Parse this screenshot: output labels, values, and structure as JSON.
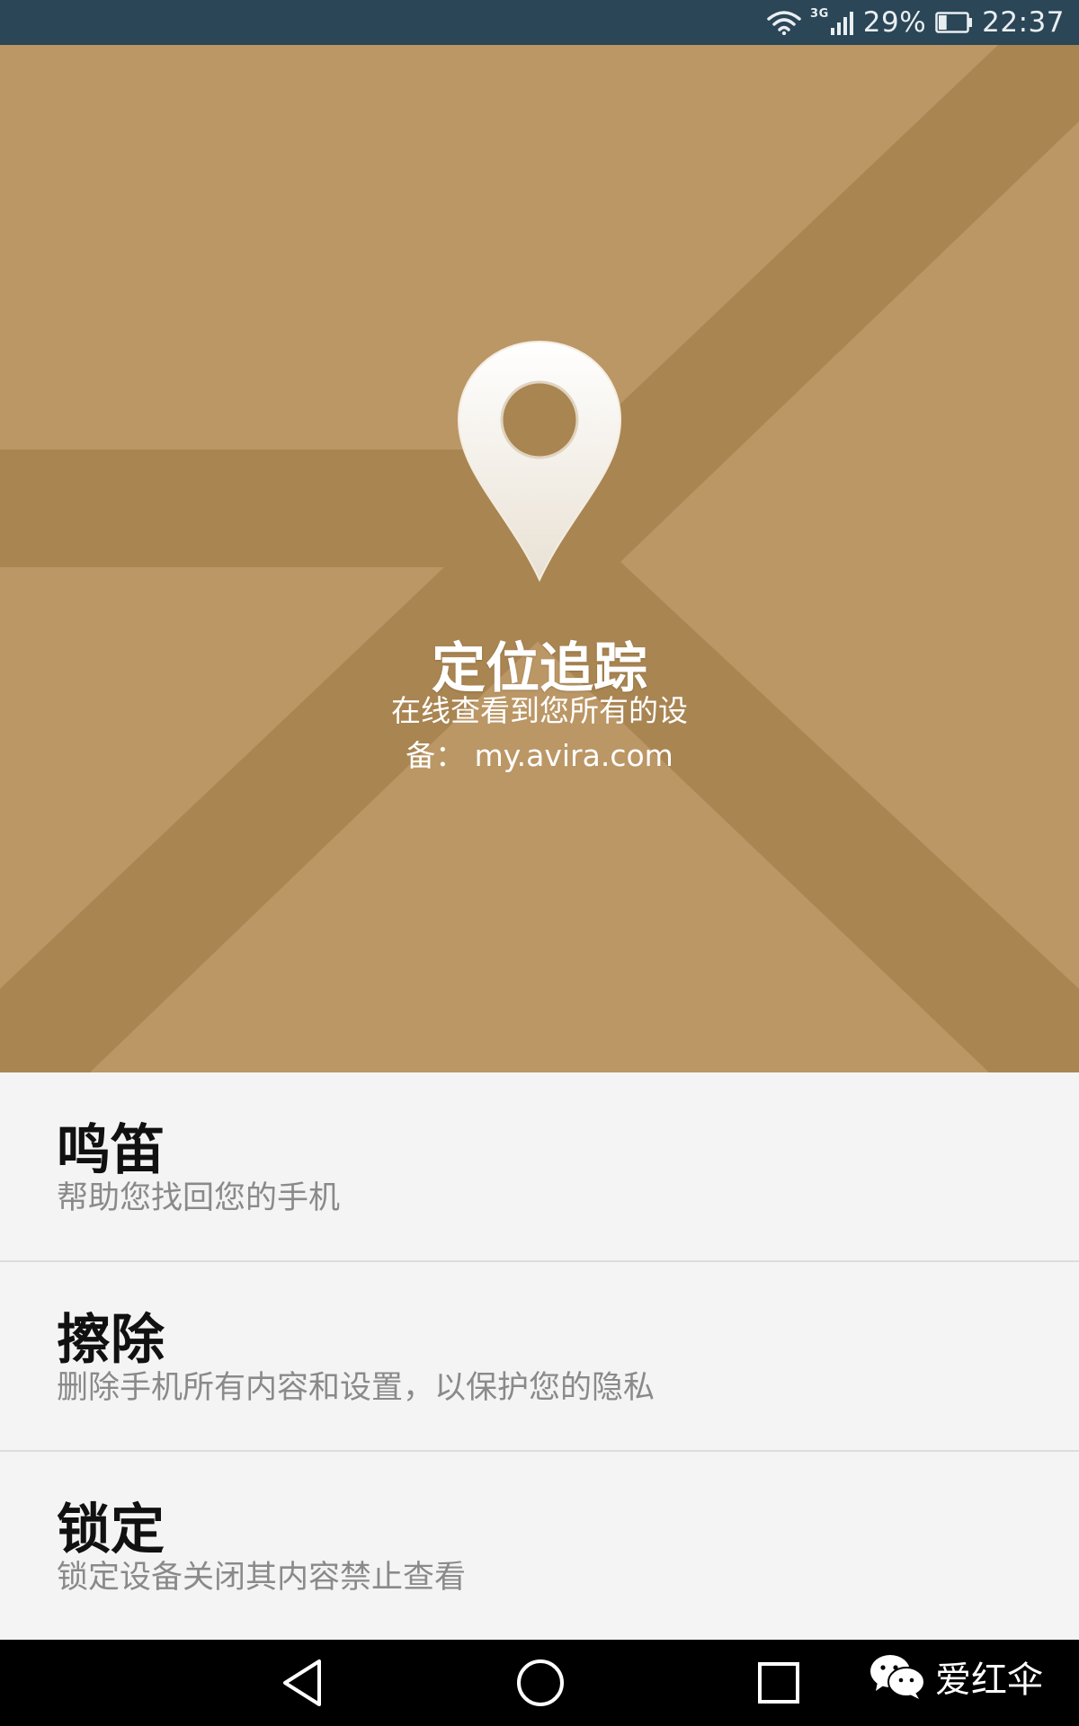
{
  "status_bar": {
    "network_type": "3G",
    "battery_percent": "29%",
    "battery_level": 0.29,
    "time": "22:37"
  },
  "hero": {
    "title": "定位追踪",
    "description": "在线查看到您所有的设备： my.avira.com"
  },
  "features": [
    {
      "title": "鸣笛",
      "subtitle": "帮助您找回您的手机"
    },
    {
      "title": "擦除",
      "subtitle": "删除手机所有内容和设置，以保护您的隐私"
    },
    {
      "title": "锁定",
      "subtitle": "锁定设备关闭其内容禁止查看"
    }
  ],
  "watermark": {
    "label": "爱红伞",
    "icon": "wechat-icon"
  },
  "colors": {
    "status_bar": "#2a4657",
    "map_background": "#bb9766",
    "map_road": "#a98552",
    "list_background": "#f4f4f4",
    "nav_bar": "#000000"
  }
}
